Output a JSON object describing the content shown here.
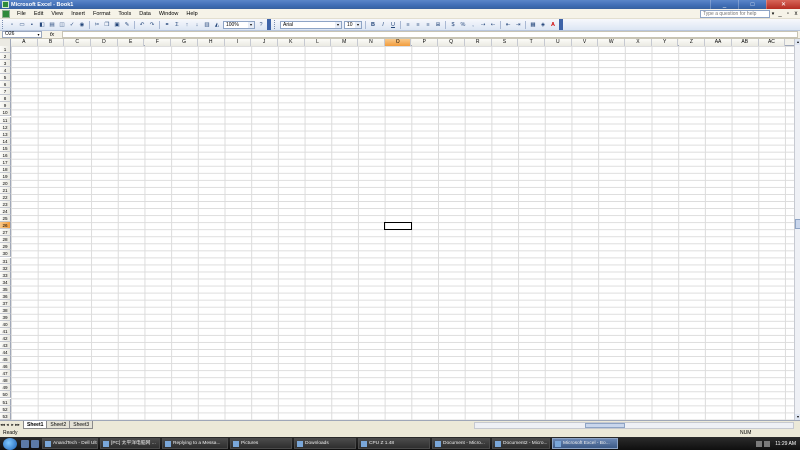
{
  "window": {
    "title": "Microsoft Excel - Book1",
    "min": "_",
    "max": "□",
    "close": "✕"
  },
  "menu": {
    "items": [
      "File",
      "Edit",
      "View",
      "Insert",
      "Format",
      "Tools",
      "Data",
      "Window",
      "Help"
    ],
    "help_placeholder": "Type a question for help",
    "help_arrow": "▾",
    "doc_min": "_",
    "doc_restore": "▫",
    "doc_close": "x"
  },
  "toolbar": {
    "autosum": "Σ",
    "zoom": "100%",
    "font": "Arial",
    "font_size": "10",
    "bold": "B",
    "italic": "I",
    "underline": "U",
    "currency": "$",
    "percent": "%",
    "font_color_glyph": "A"
  },
  "formula_bar": {
    "name_box": "O26",
    "fx": "fx",
    "content": ""
  },
  "grid": {
    "columns": [
      "A",
      "B",
      "C",
      "D",
      "E",
      "F",
      "G",
      "H",
      "I",
      "J",
      "K",
      "L",
      "M",
      "N",
      "O",
      "P",
      "Q",
      "R",
      "S",
      "T",
      "U",
      "V",
      "W",
      "X",
      "Y",
      "Z",
      "AA",
      "AB",
      "AC"
    ],
    "row_count": 53,
    "active_column": "O",
    "active_row": 26
  },
  "sheets": {
    "tabs": [
      "Sheet1",
      "Sheet2",
      "Sheet3"
    ],
    "active": "Sheet1",
    "nav": [
      "◂◂",
      "◂",
      "▸",
      "▸▸"
    ]
  },
  "status": {
    "ready": "Ready",
    "num": "NUM"
  },
  "taskbar": {
    "tasks": [
      {
        "label": "AnandTech - Dell Ult...",
        "active": false
      },
      {
        "label": "[PC] 太平洋电脑网 ...",
        "active": false
      },
      {
        "label": "Replying to a Messa...",
        "active": false
      },
      {
        "label": "Pictures",
        "active": false
      },
      {
        "label": "Downloads",
        "active": false
      },
      {
        "label": "CPU Z 1.48",
        "active": false
      },
      {
        "label": "Document - Micro...",
        "active": false
      },
      {
        "label": "Document2 - Micro...",
        "active": false
      },
      {
        "label": "Microsoft Excel - Bo...",
        "active": true
      }
    ],
    "clock": "11:29 AM"
  }
}
